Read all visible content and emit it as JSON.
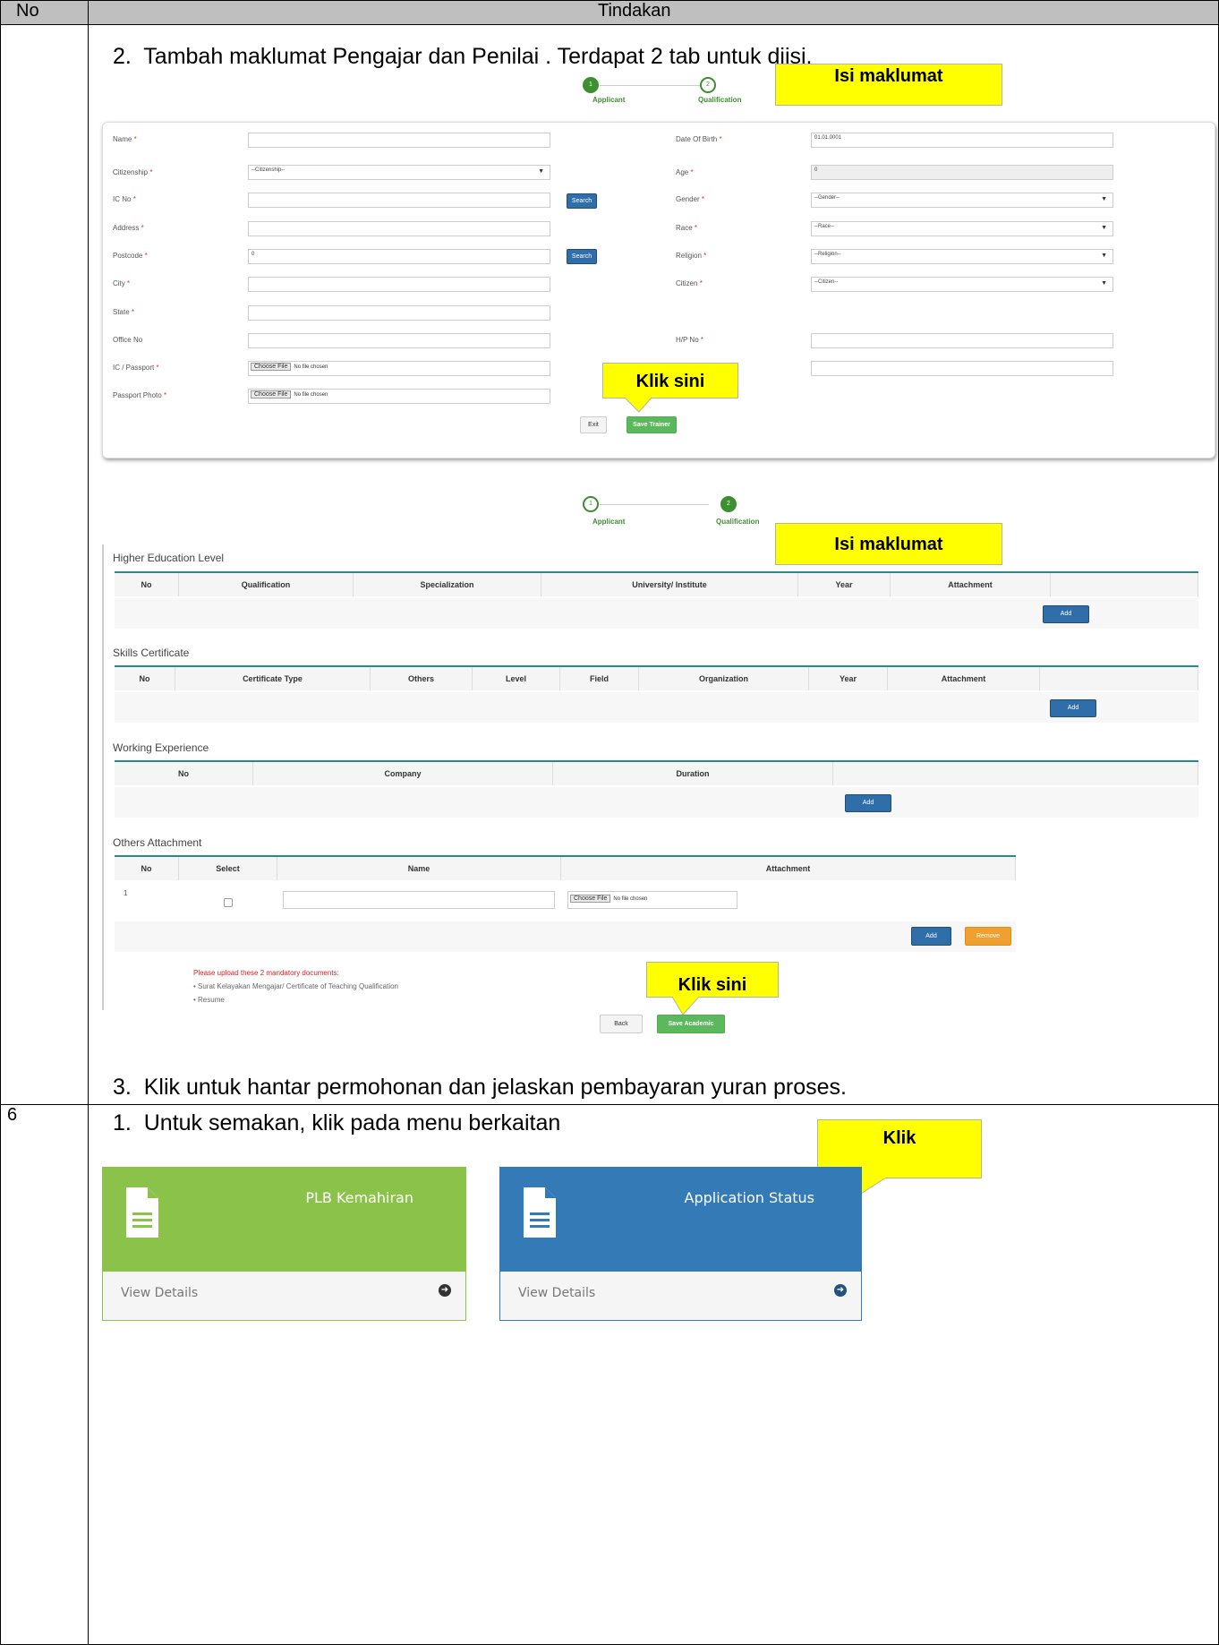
{
  "table": {
    "col_no": "No",
    "col_action": "Tindakan",
    "row_number": "6"
  },
  "step2_text": "2.  Tambah maklumat Pengajar dan Penilai . Terdapat 2 tab untuk diisi.",
  "step3_text": "3.  Klik untuk hantar permohonan dan jelaskan pembayaran yuran proses.",
  "row6_step1_text": "1.  Untuk semakan, klik pada menu berkaitan",
  "callouts": {
    "isi1": "Isi maklumat",
    "klik1": "Klik sini",
    "isi2": "Isi maklumat",
    "klik2": "Klik sini",
    "klik3": "Klik"
  },
  "wizard": {
    "step1_num": "1",
    "step1_label": "Applicant",
    "step2_num": "2",
    "step2_label": "Qualification"
  },
  "applicant_form": {
    "name_label": "Name",
    "citizenship_label": "Citizenship",
    "citizenship_value": "--Citizenship--",
    "icno_label": "IC No",
    "address_label": "Address",
    "postcode_label": "Postcode",
    "postcode_value": "0",
    "city_label": "City",
    "state_label": "State",
    "officeno_label": "Office No",
    "icpassport_label": "IC / Passport",
    "passportphoto_label": "Passport Photo",
    "dob_label": "Date Of Birth",
    "dob_value": "01.01.0001",
    "age_label": "Age",
    "age_value": "0",
    "gender_label": "Gender",
    "gender_value": "--Gender--",
    "race_label": "Race",
    "race_value": "--Race--",
    "religion_label": "Religion",
    "religion_value": "--Religion--",
    "citizen_label": "Citizen",
    "citizen_value": "--Citizen--",
    "hpno_label": "H/P No",
    "required_mark": "*",
    "search_label": "Search",
    "choose_file": "Choose File",
    "no_file": "No file chosen",
    "exit_label": "Exit",
    "save_trainer_label": "Save Trainer"
  },
  "qualification": {
    "higher_edu_title": "Higher Education Level",
    "higher_edu_cols": [
      "No",
      "Qualification",
      "Specialization",
      "University/ Institute",
      "Year",
      "Attachment"
    ],
    "skills_title": "Skills Certificate",
    "skills_cols": [
      "No",
      "Certificate Type",
      "Others",
      "Level",
      "Field",
      "Organization",
      "Year",
      "Attachment"
    ],
    "work_title": "Working Experience",
    "work_cols": [
      "No",
      "Company",
      "Duration"
    ],
    "others_title": "Others Attachment",
    "others_cols": [
      "No",
      "Select",
      "Name",
      "Attachment"
    ],
    "others_row_no": "1",
    "add_label": "Add",
    "remove_label": "Remove",
    "choose_file": "Choose File",
    "no_file": "No file chosen",
    "notice_title": "Please upload these 2 mandatory documents:",
    "notice_item1": "• Surat Kelayakan Mengajar/ Certificate of Teaching Qualification",
    "notice_item2": "• Resume",
    "back_label": "Back",
    "save_academic_label": "Save Academic"
  },
  "tiles": [
    {
      "title": "PLB Kemahiran",
      "link": "View Details",
      "color": "#8bc34a"
    },
    {
      "title": "Application Status",
      "link": "View Details",
      "color": "#337ab7"
    }
  ]
}
